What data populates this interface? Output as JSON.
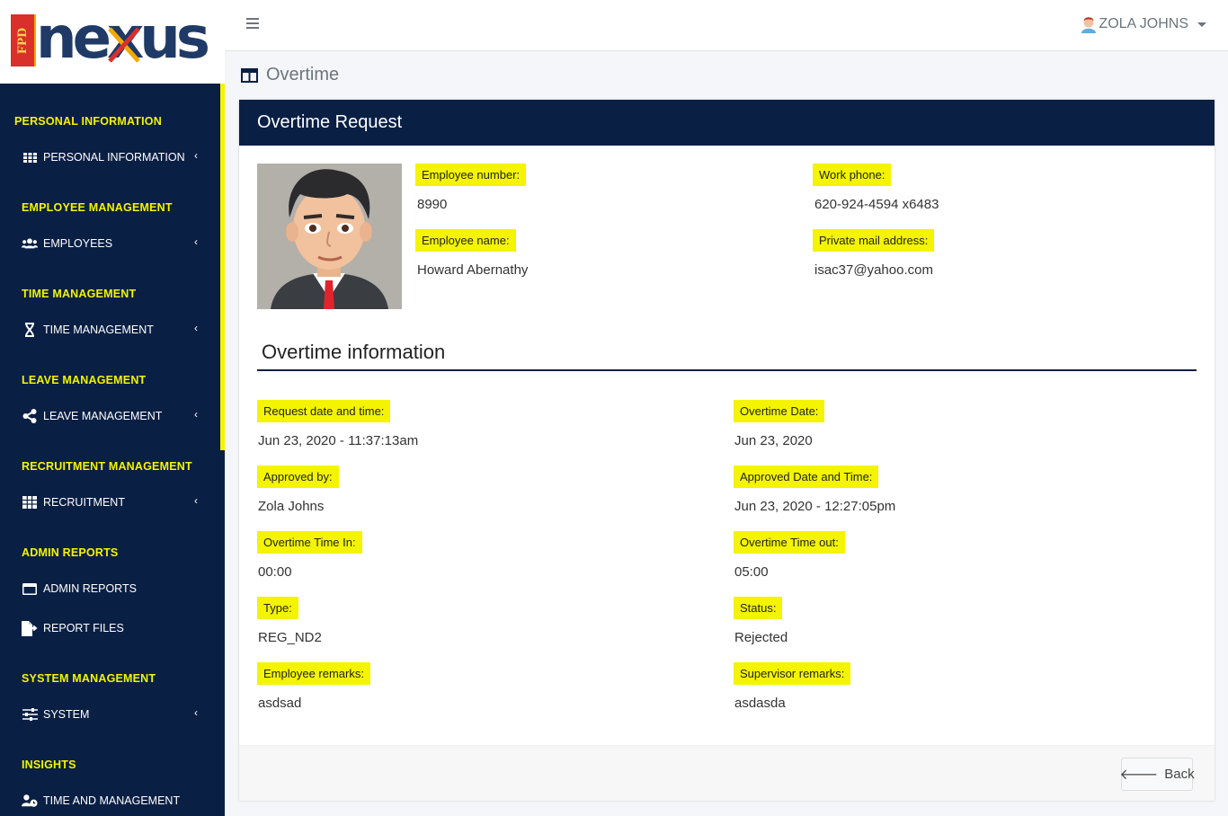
{
  "brand": {
    "logo_small": "FPD",
    "logo_text": "nexus"
  },
  "sidebar": {
    "sections": [
      {
        "title": "PERSONAL INFORMATION",
        "items": [
          {
            "label": "PERSONAL INFORMATION",
            "icon": "grid-icon",
            "has_caret": true
          }
        ]
      },
      {
        "title": "EMPLOYEE MANAGEMENT",
        "items": [
          {
            "label": "EMPLOYEES",
            "icon": "users-icon",
            "has_caret": true
          }
        ]
      },
      {
        "title": "TIME MANAGEMENT",
        "items": [
          {
            "label": "TIME MANAGEMENT",
            "icon": "hourglass-icon",
            "has_caret": true
          }
        ]
      },
      {
        "title": "LEAVE MANAGEMENT",
        "items": [
          {
            "label": "LEAVE MANAGEMENT",
            "icon": "share-icon",
            "has_caret": true
          }
        ]
      },
      {
        "title": "RECRUITMENT MANAGEMENT",
        "items": [
          {
            "label": "RECRUITMENT",
            "icon": "table-icon",
            "has_caret": true
          }
        ]
      },
      {
        "title": "ADMIN REPORTS",
        "items": [
          {
            "label": "ADMIN REPORTS",
            "icon": "card-icon",
            "has_caret": false
          },
          {
            "label": "REPORT FILES",
            "icon": "file-export-icon",
            "has_caret": false
          }
        ]
      },
      {
        "title": "SYSTEM MANAGEMENT",
        "items": [
          {
            "label": "SYSTEM",
            "icon": "sliders-icon",
            "has_caret": true
          }
        ]
      },
      {
        "title": "INSIGHTS",
        "items": [
          {
            "label": "TIME AND MANAGEMENT",
            "icon": "user-clock-icon",
            "has_caret": false
          }
        ]
      }
    ],
    "caret": "‹"
  },
  "topbar": {
    "user_name": "ZOLA JOHNS"
  },
  "page": {
    "title": "Overtime"
  },
  "card": {
    "header": "Overtime Request",
    "employee": {
      "number_label": "Employee number:",
      "number": "8990",
      "name_label": "Employee name:",
      "name": "Howard Abernathy",
      "phone_label": "Work phone:",
      "phone": "620-924-4594 x6483",
      "mail_label": "Private mail address:",
      "mail": "isac37@yahoo.com"
    },
    "section_title": "Overtime information",
    "fields": {
      "request_label": "Request date and time:",
      "request": "Jun 23, 2020 - 11:37:13am",
      "ot_date_label": "Overtime Date:",
      "ot_date": "Jun 23, 2020",
      "approved_by_label": "Approved by:",
      "approved_by": "Zola Johns",
      "approved_dt_label": "Approved Date and Time:",
      "approved_dt": "Jun 23, 2020 - 12:27:05pm",
      "time_in_label": "Overtime Time In:",
      "time_in": "00:00",
      "time_out_label": "Overtime Time out:",
      "time_out": "05:00",
      "type_label": "Type:",
      "type": "REG_ND2",
      "status_label": "Status:",
      "status": "Rejected",
      "emp_remarks_label": "Employee remarks:",
      "emp_remarks": "asdsad",
      "sup_remarks_label": "Supervisor remarks:",
      "sup_remarks": "asdasda"
    },
    "back_label": "Back"
  },
  "colors": {
    "navy": "#0a1f44",
    "highlight": "#f4f400"
  }
}
